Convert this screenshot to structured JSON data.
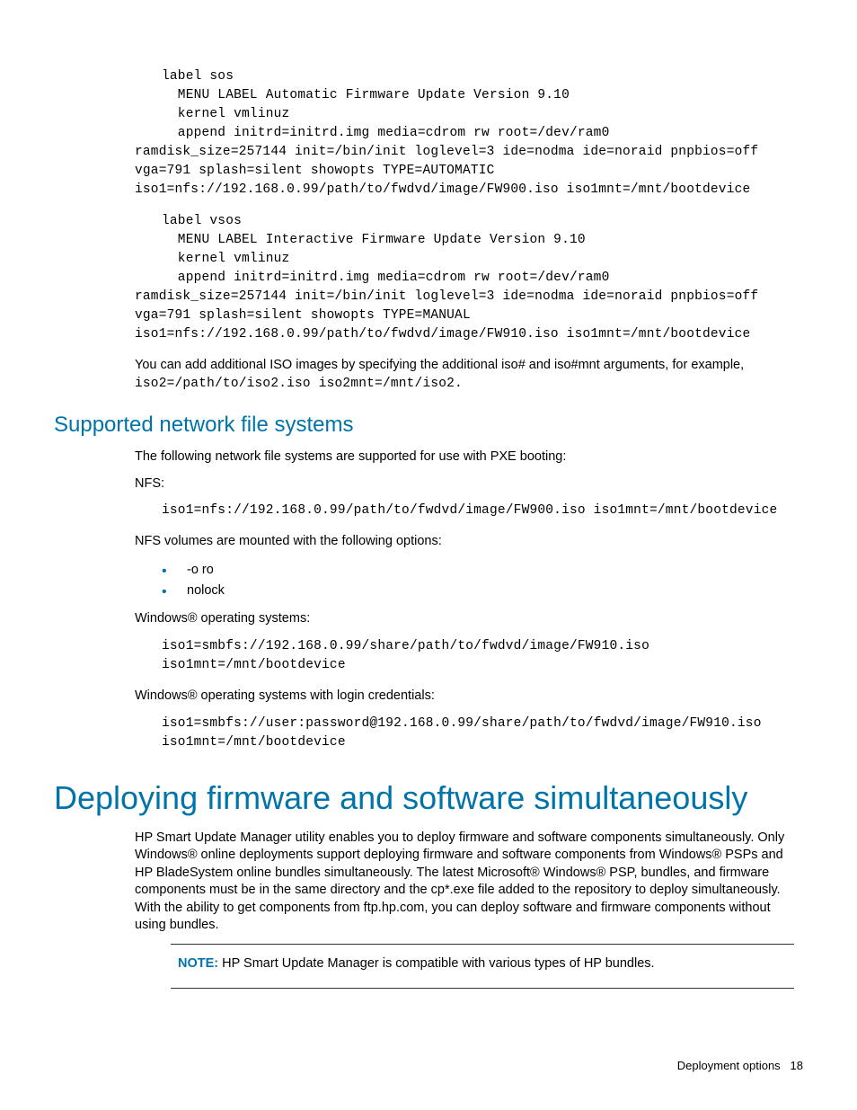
{
  "codeblock1": "label sos\n  MENU LABEL Automatic Firmware Update Version 9.10\n  kernel vmlinuz\n  append initrd=initrd.img media=cdrom rw root=/dev/ram0",
  "codeblock1b": "ramdisk_size=257144 init=/bin/init loglevel=3 ide=nodma ide=noraid pnpbios=off vga=791 splash=silent showopts TYPE=AUTOMATIC iso1=nfs://192.168.0.99/path/to/fwdvd/image/FW900.iso iso1mnt=/mnt/bootdevice",
  "codeblock2": "label vsos\n  MENU LABEL Interactive Firmware Update Version 9.10\n  kernel vmlinuz\n  append initrd=initrd.img media=cdrom rw root=/dev/ram0",
  "codeblock2b": "ramdisk_size=257144 init=/bin/init loglevel=3 ide=nodma ide=noraid pnpbios=off vga=791 splash=silent showopts TYPE=MANUAL iso1=nfs://192.168.0.99/path/to/fwdvd/image/FW910.iso iso1mnt=/mnt/bootdevice",
  "para1a": "You can add additional ISO images by specifying the additional iso# and iso#mnt arguments, for example, ",
  "para1b": "iso2=/path/to/iso2.iso iso2mnt=/mnt/iso2.",
  "h2_1": "Supported network file systems",
  "para2": "The following network file systems are supported for use with PXE booting:",
  "para3": "NFS:",
  "codeblock3": "iso1=nfs://192.168.0.99/path/to/fwdvd/image/FW900.iso iso1mnt=/mnt/bootdevice",
  "para4": "NFS volumes are mounted with the following options:",
  "bullet1": "-o ro",
  "bullet2": "nolock",
  "para5": "Windows® operating systems:",
  "codeblock4": "iso1=smbfs://192.168.0.99/share/path/to/fwdvd/image/FW910.iso iso1mnt=/mnt/bootdevice",
  "para6": "Windows® operating systems with login credentials:",
  "codeblock5": "iso1=smbfs://user:password@192.168.0.99/share/path/to/fwdvd/image/FW910.iso iso1mnt=/mnt/bootdevice",
  "h1_1": "Deploying firmware and software simultaneously",
  "para7": "HP Smart Update Manager utility enables you to deploy firmware and software components simultaneously. Only Windows® online deployments support deploying firmware and software components from Windows® PSPs and HP BladeSystem online bundles simultaneously. The latest Microsoft® Windows® PSP, bundles, and firmware components must be in the same directory and the cp*.exe file added to the repository to deploy simultaneously. With the ability to get components from ftp.hp.com, you can deploy software and firmware components without using bundles.",
  "note_label": "NOTE:",
  "note_text": "  HP Smart Update Manager is compatible with various types of HP bundles.",
  "footer_label": "Deployment options",
  "footer_page": "18"
}
